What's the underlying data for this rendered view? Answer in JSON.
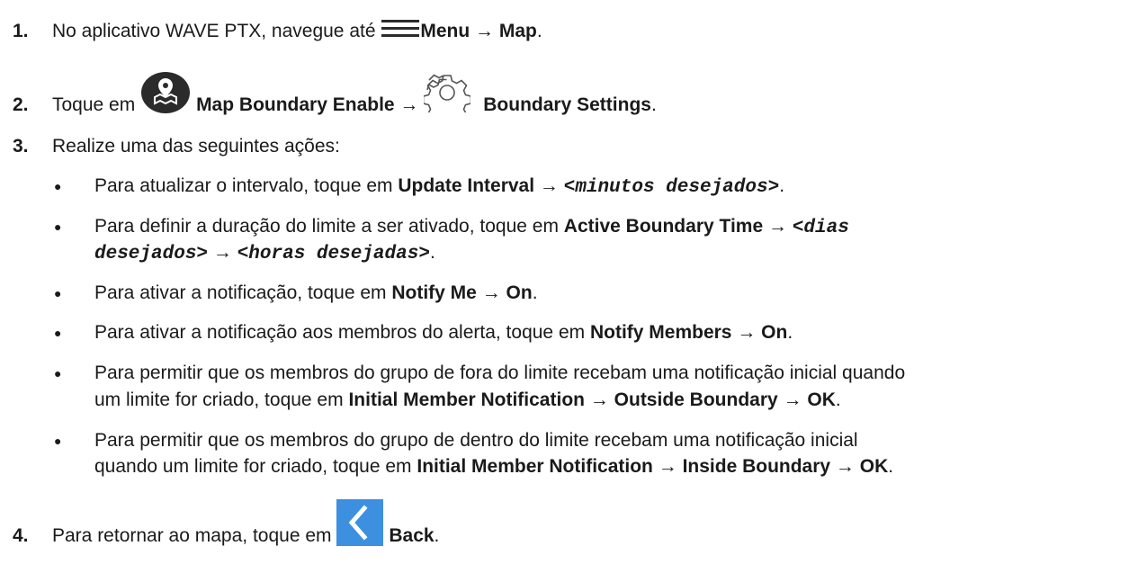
{
  "steps": [
    {
      "num": "1.",
      "pre": "No aplicativo WAVE PTX, navegue até ",
      "icon": "menu-icon",
      "b1": "Menu",
      "arrow": " → ",
      "b2": "Map",
      "end": "."
    },
    {
      "num": "2.",
      "pre": "Toque em ",
      "icon1": "map-boundary-icon",
      "b1": "Map Boundary Enable",
      "arrow": " → ",
      "icon2": "gear-icon",
      "b2": "Boundary Settings",
      "end": "."
    },
    {
      "num": "3.",
      "text": "Realize uma das seguintes ações:"
    },
    {
      "num": "4.",
      "pre": "Para retornar ao mapa, toque em ",
      "icon": "back-chevron-icon",
      "b1": "Back",
      "end": "."
    }
  ],
  "bullets": [
    {
      "pre": "Para atualizar o intervalo, toque em ",
      "b1": "Update Interval",
      "arrow": " → ",
      "m1": "<minutos desejados>",
      "end": "."
    },
    {
      "pre": "Para definir a duração do limite a ser ativado, toque em ",
      "b1": "Active Boundary Time",
      "arrow": " → ",
      "m1": "<dias",
      "m2": "desejados>",
      "arrow2": " → ",
      "m3": "<horas desejadas>",
      "end": "."
    },
    {
      "pre": "Para ativar a notificação, toque em ",
      "b1": "Notify Me",
      "arrow": " → ",
      "b2": "On",
      "end": "."
    },
    {
      "pre": "Para ativar a notificação aos membros do alerta, toque em ",
      "b1": "Notify Members",
      "arrow": " → ",
      "b2": "On",
      "end": "."
    },
    {
      "line1": "Para permitir que os membros do grupo de fora do limite recebam uma notificação inicial quando",
      "pre": "um limite for criado, toque em ",
      "b1": "Initial Member Notification",
      "arrow": " → ",
      "b2": "Outside Boundary",
      "arrow2": " → ",
      "b3": "OK",
      "end": "."
    },
    {
      "line1": "Para permitir que os membros do grupo de dentro do limite recebam uma notificação inicial",
      "pre": "quando um limite for criado, toque em ",
      "b1": "Initial Member Notification",
      "arrow": " → ",
      "b2": "Inside Boundary",
      "arrow2": " → ",
      "b3": "OK",
      "end": "."
    }
  ],
  "bullet_char": "●",
  "colors": {
    "text": "#1a1a1a",
    "icon_dark": "#2b2b2b",
    "back_blue": "#3d8fe0"
  }
}
